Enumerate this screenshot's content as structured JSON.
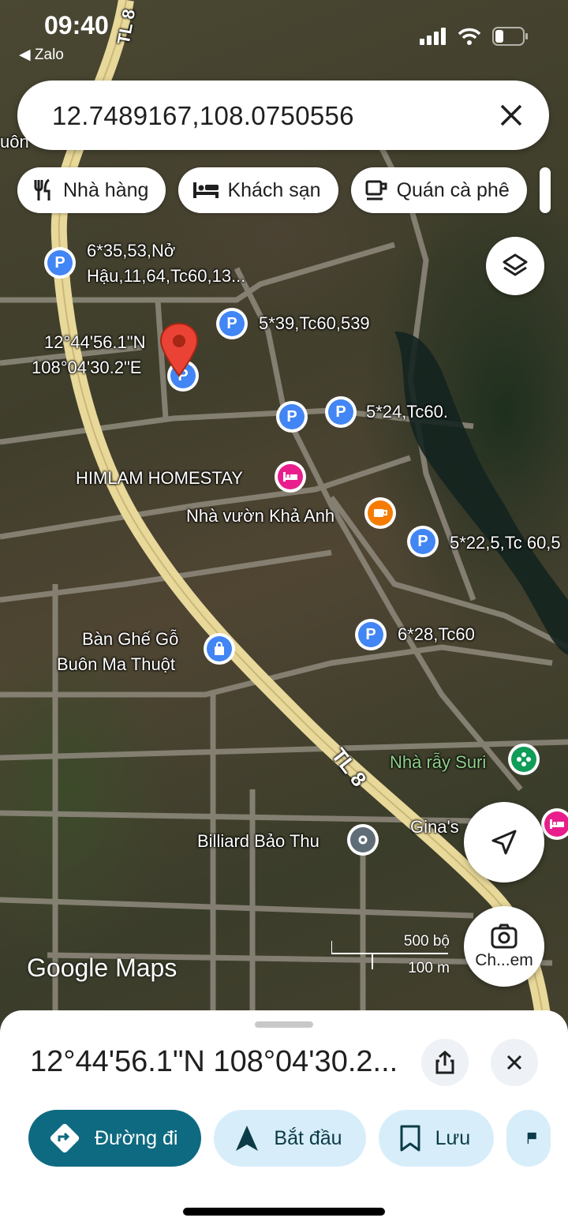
{
  "status_bar": {
    "time": "09:40",
    "back_app": "◀ Zalo"
  },
  "search": {
    "query": "12.7489167,108.0750556"
  },
  "chips": [
    {
      "icon": "restaurant-icon",
      "label": "Nhà hàng"
    },
    {
      "icon": "hotel-icon",
      "label": "Khách sạn"
    },
    {
      "icon": "coffee-icon",
      "label": "Quán cà phê"
    }
  ],
  "map": {
    "road_label": "TL 8",
    "road_label_top": "TL 8",
    "edge_text": "uôn",
    "dropped_pin_label": [
      "12°44'56.1\"N",
      "108°04'30.2\"E"
    ],
    "places": [
      {
        "name": "6*35,53,Nở",
        "name2": "Hậu,11,64,Tc60,13...",
        "type": "parking-icon"
      },
      {
        "name": "5*39,Tc60,539",
        "type": "parking-icon"
      },
      {
        "name": "5*24,Tc60.",
        "type": "parking-icon"
      },
      {
        "name": "HIMLAM HOMESTAY",
        "type": "hotel-icon"
      },
      {
        "name": "Nhà vườn Khả Anh",
        "type": "coffee-icon"
      },
      {
        "name": "5*22,5,Tc 60,5",
        "type": "parking-icon"
      },
      {
        "name": "6*28,Tc60",
        "type": "parking-icon"
      },
      {
        "name": "Bàn Ghế Gỗ",
        "name2": "Buôn Ma Thuột",
        "type": "shopping-icon"
      },
      {
        "name": "Nhà rẫy Suri",
        "type": "flower-icon"
      },
      {
        "name": "Billiard Bảo Thu",
        "type": "pin-icon"
      },
      {
        "name": "Gina's",
        "type": "hotel-icon"
      }
    ],
    "logo": "Google Maps",
    "scale": {
      "imperial": "500 bộ",
      "metric": "100 m"
    },
    "camera_label": "Ch...em"
  },
  "sheet": {
    "title": "12°44'56.1\"N 108°04'30.2...",
    "actions": [
      {
        "label": "Đường đi",
        "icon": "directions-icon"
      },
      {
        "label": "Bắt đầu",
        "icon": "navigation-icon"
      },
      {
        "label": "Lưu",
        "icon": "bookmark-icon"
      }
    ]
  },
  "colors": {
    "accent": "#0e6a80",
    "pin_blue": "#4285f4",
    "pin_red": "#ea4335",
    "hotel_pink": "#e91e8c",
    "cafe_orange": "#f57c00"
  }
}
